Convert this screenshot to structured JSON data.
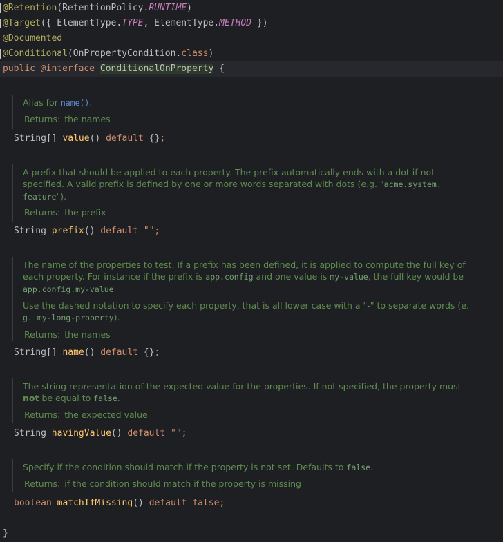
{
  "annotations": {
    "retention": "@Retention",
    "retention_args_open": "(RetentionPolicy.",
    "runtime": "RUNTIME",
    "retention_args_close": ")",
    "target": "@Target",
    "target_args_1": "({ ElementType.",
    "type": "TYPE",
    "target_args_2": ", ElementType.",
    "method": "METHOD",
    "target_args_3": " })",
    "documented": "@Documented",
    "conditional": "@Conditional",
    "conditional_args_1": "(OnPropertyCondition.",
    "class_kw": "class",
    "conditional_args_2": ")"
  },
  "declaration": {
    "public": "public",
    "interface": "@interface",
    "name": "ConditionalOnProperty",
    "open": " {"
  },
  "members": [
    {
      "doc_lines": [
        "Alias for ",
        "name()",
        "."
      ],
      "returns_label": "Returns:",
      "returns_text": "the names",
      "type": "String[]",
      "name": "value",
      "parens": "()",
      "default_kw": "default",
      "default_val": "{}",
      "semi": ";"
    },
    {
      "doc_text_1": "A prefix that should be applied to each property. The prefix automatically ends with a dot if not",
      "doc_text_2": "specified. A valid prefix is defined by one or more words separated with dots (e.g. \"",
      "doc_mono_2": "acme.system.",
      "doc_mono_3": "feature",
      "doc_text_3": "\").",
      "returns_label": "Returns:",
      "returns_text": "the prefix",
      "type": "String",
      "name": "prefix",
      "parens": "()",
      "default_kw": "default",
      "default_val": "\"\"",
      "semi": ";"
    },
    {
      "doc_text_1": "The name of the properties to test. If a prefix has been defined, it is applied to compute the full key of",
      "doc_text_2a": "each property. For instance if the prefix is ",
      "doc_mono_2a": "app.config",
      "doc_text_2b": " and one value is ",
      "doc_mono_2b": "my-value",
      "doc_text_2c": ", the full key would be",
      "doc_mono_3": "app.config.my-value",
      "doc_text_4": "Use the dashed notation to specify each property, that is all lower case with a \"-\" to separate words (e.",
      "doc_mono_5": "g. my-long-property",
      "doc_text_5": ").",
      "returns_label": "Returns:",
      "returns_text": "the names",
      "type": "String[]",
      "name": "name",
      "parens": "()",
      "default_kw": "default",
      "default_val": "{}",
      "semi": ";"
    },
    {
      "doc_text_1": "The string representation of the expected value for the properties. If not specified, the property must",
      "doc_bold_2": "not",
      "doc_text_2": " be equal to ",
      "doc_mono_2": "false",
      "doc_text_2b": ".",
      "returns_label": "Returns:",
      "returns_text": "the expected value",
      "type": "String",
      "name": "havingValue",
      "parens": "()",
      "default_kw": "default",
      "default_val": "\"\"",
      "semi": ";"
    },
    {
      "doc_text_1": "Specify if the condition should match if the property is not set. Defaults to ",
      "doc_mono_1": "false",
      "doc_text_1b": ".",
      "returns_label": "Returns:",
      "returns_text": "if the condition should match if the property is missing",
      "type": "boolean",
      "name": "matchIfMissing",
      "parens": "()",
      "default_kw": "default",
      "default_val": "false",
      "semi": ";"
    }
  ],
  "closing_brace": "}"
}
